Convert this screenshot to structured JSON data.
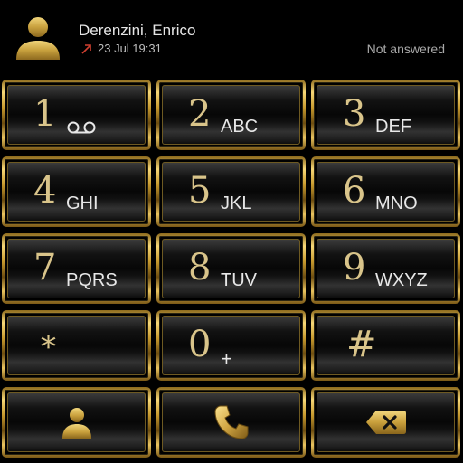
{
  "call_log": {
    "contact_name": "Derenzini, Enrico",
    "date_time": "23 Jul 19:31",
    "status": "Not answered"
  },
  "dialpad": {
    "keys": [
      {
        "digit": "1",
        "letters": ""
      },
      {
        "digit": "2",
        "letters": "ABC"
      },
      {
        "digit": "3",
        "letters": "DEF"
      },
      {
        "digit": "4",
        "letters": "GHI"
      },
      {
        "digit": "5",
        "letters": "JKL"
      },
      {
        "digit": "6",
        "letters": "MNO"
      },
      {
        "digit": "7",
        "letters": "PQRS"
      },
      {
        "digit": "8",
        "letters": "TUV"
      },
      {
        "digit": "9",
        "letters": "WXYZ"
      },
      {
        "digit": "*",
        "letters": ""
      },
      {
        "digit": "0",
        "letters": "+"
      },
      {
        "digit": "#",
        "letters": ""
      }
    ]
  },
  "icons": {
    "avatar": "person-icon",
    "call_direction": "outgoing-call-arrow-icon",
    "voicemail": "voicemail-icon",
    "contacts": "contacts-icon",
    "call": "phone-icon",
    "backspace": "backspace-icon"
  },
  "colors": {
    "gold": "#c8a64a",
    "gold_text": "#d9c48a",
    "background": "#000000",
    "missed_arrow": "#d04030"
  }
}
